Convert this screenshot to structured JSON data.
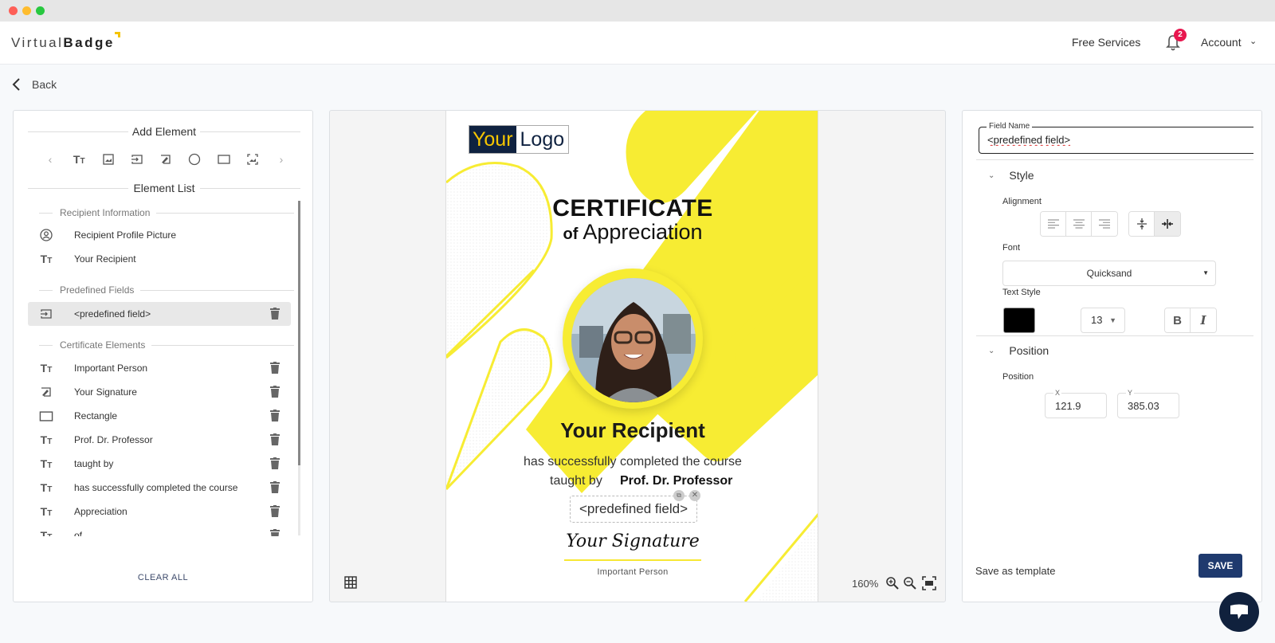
{
  "app": {
    "brand_thin": "Virtual",
    "brand_bold": "Badge"
  },
  "header": {
    "free_services": "Free Services",
    "notifications_count": "2",
    "account": "Account"
  },
  "nav": {
    "back": "Back"
  },
  "left_panel": {
    "add_element_title": "Add Element",
    "tools": [
      {
        "icon": "text-icon"
      },
      {
        "icon": "image-icon"
      },
      {
        "icon": "field-icon"
      },
      {
        "icon": "signature-icon"
      },
      {
        "icon": "circle-icon"
      },
      {
        "icon": "rectangle-icon"
      },
      {
        "icon": "qr-image-icon"
      }
    ],
    "element_list_title": "Element List",
    "groups": {
      "recipient_info": "Recipient Information",
      "predefined_fields": "Predefined Fields",
      "certificate_elements": "Certificate Elements"
    },
    "recipient_items": [
      {
        "label": "Recipient Profile Picture",
        "icon": "profile-icon"
      },
      {
        "label": "Your Recipient",
        "icon": "text-icon"
      }
    ],
    "predefined_items": [
      {
        "label": "<predefined field>",
        "icon": "field-icon",
        "selected": true
      }
    ],
    "certificate_items": [
      {
        "label": "Important Person",
        "icon": "text-icon"
      },
      {
        "label": "Your Signature",
        "icon": "signature-icon"
      },
      {
        "label": "Rectangle",
        "icon": "rectangle-icon"
      },
      {
        "label": "Prof. Dr. Professor",
        "icon": "text-icon"
      },
      {
        "label": "taught by",
        "icon": "text-icon"
      },
      {
        "label": "has successfully completed the course",
        "icon": "text-icon"
      },
      {
        "label": "Appreciation",
        "icon": "text-icon"
      },
      {
        "label": "of",
        "icon": "text-icon"
      }
    ],
    "clear_all": "CLEAR ALL"
  },
  "canvas": {
    "zoom_level": "160%",
    "certificate": {
      "logo_your": "Your",
      "logo_logo": "Logo",
      "title": "CERTIFICATE",
      "subtitle_of": "of",
      "subtitle_main": "Appreciation",
      "recipient": "Your Recipient",
      "completed": "has successfully completed the course",
      "taught_by": "taught by",
      "professor": "Prof. Dr. Professor",
      "predefined_field": "<predefined field>",
      "signature": "Your Signature",
      "important_person": "Important Person",
      "accent_color": "#f7ec33"
    }
  },
  "right_panel": {
    "field_name_label": "Field Name",
    "field_name_value": "<predefined field>",
    "style_title": "Style",
    "alignment_label": "Alignment",
    "font_label": "Font",
    "font_value": "Quicksand",
    "text_style_label": "Text Style",
    "text_color": "#000000",
    "font_size": "13",
    "bold_label": "B",
    "italic_label": "I",
    "position_title": "Position",
    "position_label": "Position",
    "x_label": "X",
    "x_value": "121.9",
    "y_label": "Y",
    "y_value": "385.03",
    "save_template": "Save as template",
    "save": "SAVE"
  }
}
